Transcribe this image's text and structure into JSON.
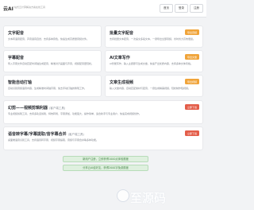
{
  "header": {
    "logo": "云AI",
    "tagline": "一站式云计算解决方案在线工具",
    "nav": [
      "首页",
      "登录",
      "注册"
    ]
  },
  "cards": [
    {
      "title": "文字配音",
      "subtitle": "",
      "badge": "",
      "desc": "文本转语音配音，声音逼真自然，支持多种音色，快速生成高质量音频文件。"
    },
    {
      "title": "批量文字配音",
      "subtitle": "",
      "badge": "导出音频",
      "desc": "支持批量文本配音，一次提交多段文本，一键导出全部音频，省时省力高效便捷。"
    },
    {
      "title": "字幕配音",
      "subtitle": "",
      "badge": "",
      "desc": "导入字幕文件自动匹配时间轴生成配音，精准对齐画面与声音，视频配音更轻松。"
    },
    {
      "title": "AI文章写作",
      "subtitle": "",
      "badge": "导出文章",
      "desc": "AI智能写作，输入主题即可生成文章，快速产出优质内容，支持多种文体风格。"
    },
    {
      "title": "智能自动打轴",
      "subtitle": "",
      "badge": "",
      "desc": "自动识别音频语音内容，生成精准时间轴字幕，免去手动打轴的繁琐工作。"
    },
    {
      "title": "文章生成视频",
      "subtitle": "",
      "badge": "导出视频",
      "desc": "输入文章内容，自动匹配素材与配音，一键生成精美视频，轻松制作短视频。"
    },
    {
      "title": "幻剪——视频剪辑利器",
      "subtitle": "(客户端工具)",
      "badge": "立即下载",
      "desc": "专业视频剪辑工具，支持多轨道剪辑、特效转场、字幕添加，功能强大，操作简单，适合新手与专业用户，快速完成视频创作。"
    },
    {
      "title": "语音转字幕/字幕提取/音字幕合并",
      "subtitle": "(客户端工具)",
      "badge": "立即下载",
      "desc": "桌面端语音识别工具，支持语音转字幕、视频字幕提取、音频与字幕合并等多种功能。"
    }
  ],
  "banners": [
    "新用户注册，立即获得1000点体验额度",
    "分享云AI给好友，获得2000字免费额度"
  ],
  "watermark": "至源码"
}
